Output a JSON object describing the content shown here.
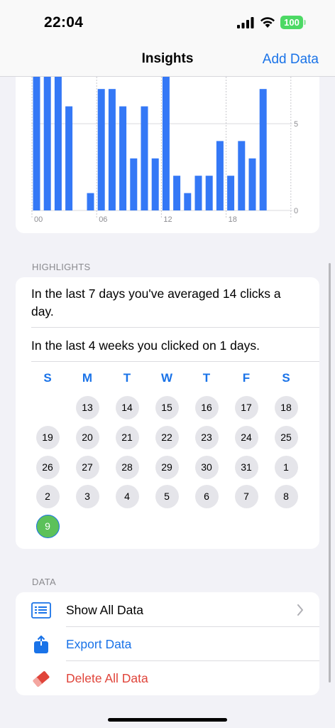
{
  "status_bar": {
    "time": "22:04",
    "battery": "100"
  },
  "nav": {
    "title": "Insights",
    "action": "Add Data"
  },
  "chart_data": {
    "type": "bar",
    "x": [
      0,
      1,
      2,
      3,
      4,
      5,
      6,
      7,
      8,
      9,
      10,
      11,
      12,
      13,
      14,
      15,
      16,
      17,
      18,
      19,
      20,
      21,
      22
    ],
    "values": [
      18,
      19,
      17,
      6,
      0,
      1,
      7,
      7,
      6,
      3,
      6,
      3,
      18,
      2,
      1,
      2,
      2,
      4,
      2,
      4,
      3,
      7,
      0
    ],
    "x_tick_labels": [
      "00",
      "06",
      "12",
      "18"
    ],
    "x_tick_positions": [
      0,
      6,
      12,
      18
    ],
    "y_tick_labels": [
      "0",
      "5"
    ],
    "y_ticks": [
      0,
      5
    ],
    "ylim": [
      0,
      10
    ],
    "bar_color": "#3478f6"
  },
  "highlights": {
    "header": "HIGHLIGHTS",
    "line1": "In the last 7 days you've averaged 14 clicks a day.",
    "line2": "In the last 4 weeks you clicked on 1 days.",
    "weekdays": [
      "S",
      "M",
      "T",
      "W",
      "T",
      "F",
      "S"
    ],
    "days": [
      "13",
      "14",
      "15",
      "16",
      "17",
      "18",
      "19",
      "20",
      "21",
      "22",
      "23",
      "24",
      "25",
      "26",
      "27",
      "28",
      "29",
      "30",
      "31",
      "1",
      "2",
      "3",
      "4",
      "5",
      "6",
      "7",
      "8",
      "9"
    ],
    "today": "9",
    "today_color": "#5cc15a"
  },
  "data_section": {
    "header": "DATA",
    "show_all": "Show All Data",
    "export": "Export Data",
    "delete": "Delete All Data",
    "accent_color": "#1a73e8",
    "danger_color": "#e0443a"
  }
}
